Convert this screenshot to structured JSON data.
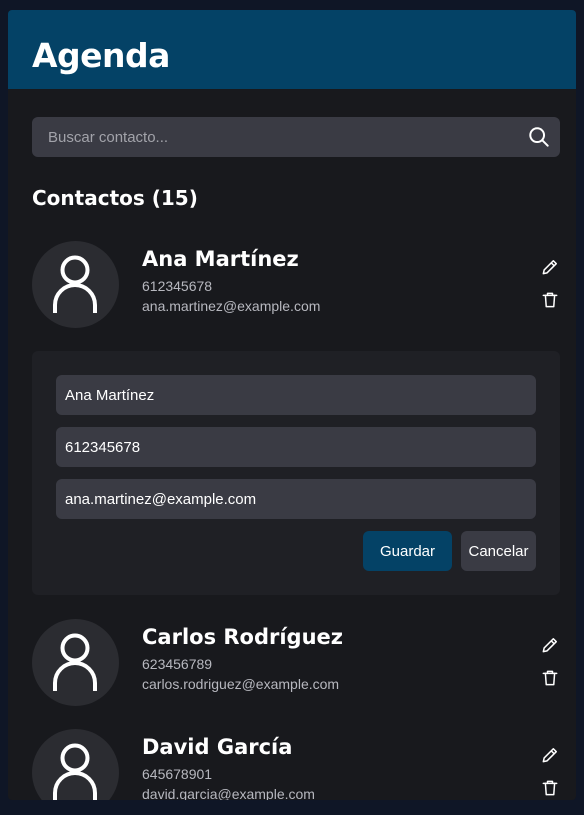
{
  "app": {
    "title": "Agenda"
  },
  "search": {
    "placeholder": "Buscar contacto...",
    "icon": "search-icon"
  },
  "contacts_heading": "Contactos (15)",
  "contacts": [
    {
      "name": "Ana Martínez",
      "phone": "612345678",
      "email": "ana.martinez@example.com"
    },
    {
      "name": "Carlos Rodríguez",
      "phone": "623456789",
      "email": "carlos.rodriguez@example.com"
    },
    {
      "name": "David García",
      "phone": "645678901",
      "email": "david.garcia@example.com"
    }
  ],
  "edit_form": {
    "name_value": "Ana Martínez",
    "phone_value": "612345678",
    "email_value": "ana.martinez@example.com",
    "save_label": "Guardar",
    "cancel_label": "Cancelar"
  },
  "colors": {
    "header": "#044266",
    "surface": "#18191d",
    "input": "#3a3b44",
    "accent": "#044266"
  }
}
